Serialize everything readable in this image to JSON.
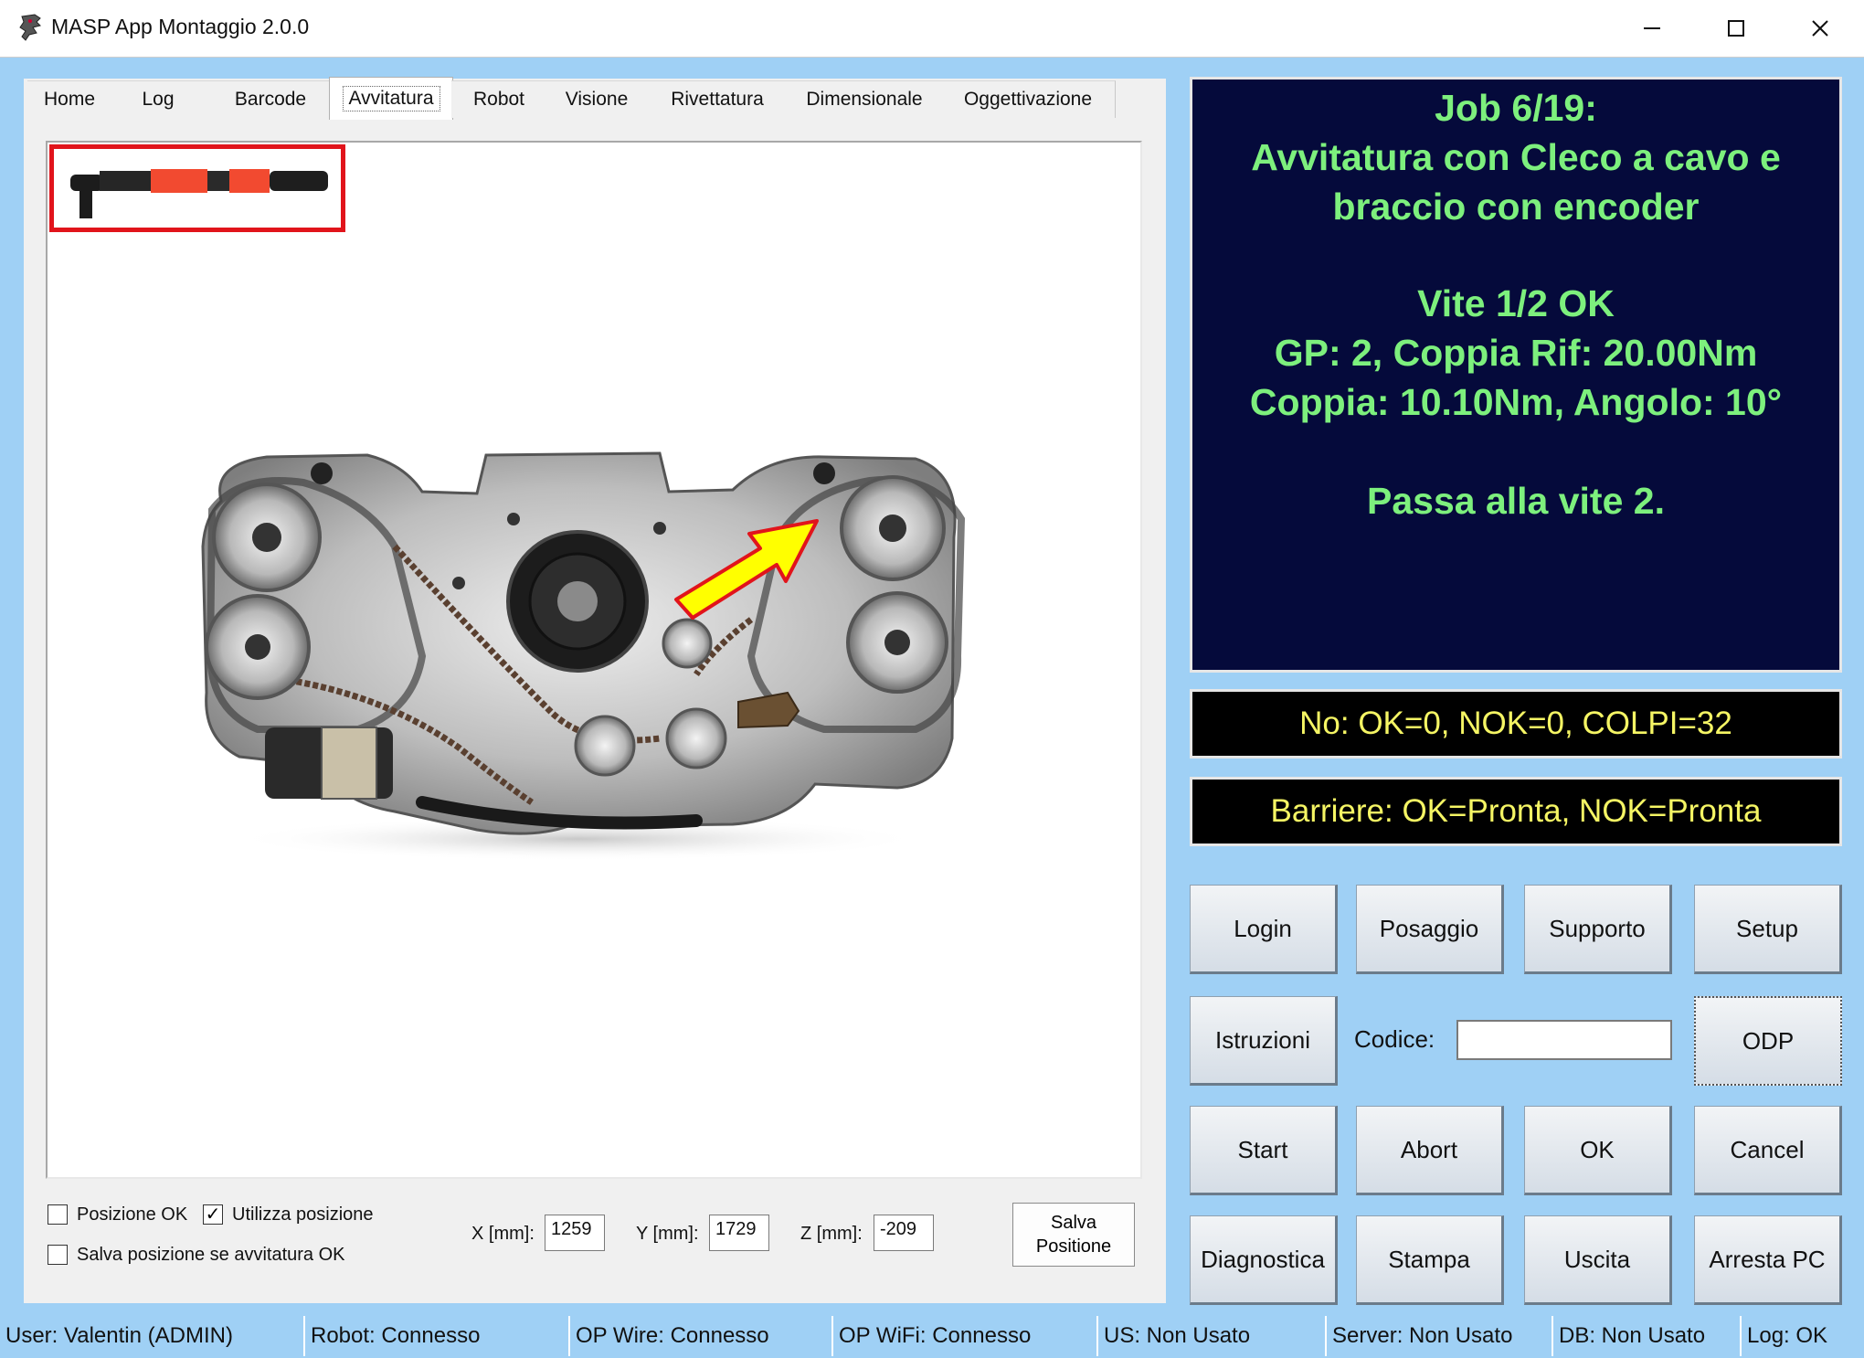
{
  "window": {
    "title": "MASP App Montaggio 2.0.0",
    "minimize": "—",
    "maximize": "☐",
    "close": "✕"
  },
  "tabs": [
    "Home",
    "Log",
    "Barcode",
    "Avvitatura",
    "Robot",
    "Visione",
    "Rivettatura",
    "Dimensionale",
    "Oggettivazione"
  ],
  "active_tab": "Avvitatura",
  "options": {
    "posizione_ok": {
      "label": "Posizione OK",
      "checked": false
    },
    "utilizza_posizione": {
      "label": "Utilizza posizione",
      "checked": true
    },
    "salva_posizione": {
      "label": "Salva posizione se avvitatura OK",
      "checked": false
    }
  },
  "coords": {
    "x_label": "X [mm]:",
    "x_value": "1259",
    "y_label": "Y [mm]:",
    "y_value": "1729",
    "z_label": "Z [mm]:",
    "z_value": "-209"
  },
  "save_position_button": [
    "Salva",
    "Positione"
  ],
  "job": {
    "header": "Job 6/19:",
    "title_line1": "Avvitatura con Cleco a cavo e",
    "title_line2": "braccio con encoder",
    "screw_status": "Vite 1/2 OK",
    "gp_line": "GP: 2, Coppia Rif: 20.00Nm",
    "torque_line": "Coppia: 10.10Nm, Angolo: 10°",
    "next_step": "Passa alla vite 2."
  },
  "counters": "No: OK=0, NOK=0, COLPI=32",
  "barriers": "Barriere: OK=Pronta, NOK=Pronta",
  "buttons": {
    "login": "Login",
    "posaggio": "Posaggio",
    "supporto": "Supporto",
    "setup": "Setup",
    "istruzioni": "Istruzioni",
    "odp": "ODP",
    "start": "Start",
    "abort": "Abort",
    "ok": "OK",
    "cancel": "Cancel",
    "diagnostica": "Diagnostica",
    "stampa": "Stampa",
    "uscita": "Uscita",
    "arresta": "Arresta PC"
  },
  "codice": {
    "label": "Codice:",
    "value": ""
  },
  "status_bar": {
    "user": "User: Valentin (ADMIN)",
    "robot": "Robot: Connesso",
    "op_wire": "OP Wire: Connesso",
    "op_wifi": "OP WiFi: Connesso",
    "us": "US: Non Usato",
    "server": "Server: Non Usato",
    "db": "DB: Non Usato",
    "log": "Log: OK"
  },
  "colors": {
    "job_bg": "#050a3b",
    "job_text": "#7df07d",
    "info_text": "#f5f564",
    "window_bg": "#9fd0f5",
    "tool_highlight": "#e1141b"
  }
}
